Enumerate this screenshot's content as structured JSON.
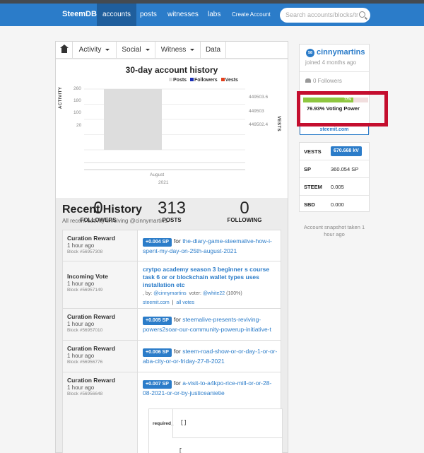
{
  "nav": {
    "brand": "SteemDB",
    "links": [
      "accounts",
      "posts",
      "witnesses",
      "labs",
      "Create Account"
    ],
    "search_placeholder": "Search accounts/blocks/tr"
  },
  "tabs": [
    "Activity",
    "Social",
    "Witness",
    "Data"
  ],
  "chart": {
    "title": "30-day account history",
    "legend": [
      {
        "label": "Posts",
        "color": "#dddddd"
      },
      {
        "label": "Followers",
        "color": "#1a2fb5"
      },
      {
        "label": "Vests",
        "color": "#e2401c"
      }
    ],
    "left_axis_label": "ACTIVITY",
    "right_axis_label": "VESTS",
    "left_ticks": [
      "260",
      "180",
      "100",
      "20"
    ],
    "right_ticks": [
      "449503.6",
      "449503",
      "449502.4"
    ],
    "x_month": "August",
    "x_year": "2021"
  },
  "chart_data": {
    "type": "bar",
    "title": "30-day account history",
    "categories": [
      "August 2021"
    ],
    "series": [
      {
        "name": "Posts",
        "values": [
          313
        ]
      }
    ],
    "ylabel": "ACTIVITY",
    "y2label": "VESTS",
    "ylim": [
      0,
      280
    ]
  },
  "stats": [
    {
      "value": "0",
      "label": "FOLLOWERS"
    },
    {
      "value": "313",
      "label": "POSTS"
    },
    {
      "value": "0",
      "label": "FOLLOWING"
    }
  ],
  "history": {
    "title": "Recent History",
    "subtitle": "All recent activity involving @cinnymartins.",
    "rows": [
      {
        "type": "Curation Reward",
        "time": "1 hour ago",
        "block": "Block #56957308",
        "badge": "+0.004 SP",
        "text": "for",
        "link": "the-diary-game-steemalive-how-i-spent-my-day-on-25th-august-2021"
      },
      {
        "type": "Incoming Vote",
        "time": "1 hour ago",
        "block": "Block #56957149",
        "vote_title": "crytpo academy season 3 beginner s course task 6 or or blockchain wallet types uses installation etc",
        "by_prefix": ", by: ",
        "author": "@cinnymartins",
        "voter_prefix": "voter: ",
        "voter": "@white22",
        "pct": "(100%)",
        "site": "steemit.com",
        "all_votes": "all votes"
      },
      {
        "type": "Curation Reward",
        "time": "1 hour ago",
        "block": "Block #56957010",
        "badge": "+0.005 SP",
        "text": "for",
        "link": "steemalive-presents-reviving-powers2soar-our-community-powerup-initiative-t"
      },
      {
        "type": "Curation Reward",
        "time": "1 hour ago",
        "block": "Block #56956776",
        "badge": "+0.006 SP",
        "text": "for",
        "link": "steem-road-show-or-or-day-1-or-or-aba-city-or-or-friday-27-8-2021"
      },
      {
        "type": "Curation Reward",
        "time": "1 hour ago",
        "block": "Block #56956648",
        "badge": "+0.007 SP",
        "text": "for",
        "link": "a-visit-to-a4kpo-rice-mill-or-or-28-08-2021-or-or-by-justiceanietie"
      }
    ],
    "sub_key": "required_",
    "sub_value": "[]",
    "sub_value2": "["
  },
  "profile": {
    "avatar": "58",
    "username": "cinnymartins",
    "joined": "joined 4 months ago",
    "followers": "0 Followers",
    "voting_power_value": 76.93,
    "voting_power_badge": "77%",
    "voting_power_text": "76.93% Voting Power",
    "steemit_link": "steemit.com"
  },
  "vests": [
    {
      "key": "VESTS",
      "value": "670.668 kV"
    },
    {
      "key": "SP",
      "value": "360.054 SP"
    },
    {
      "key": "STEEM",
      "value": "0.005"
    },
    {
      "key": "SBD",
      "value": "0.000"
    }
  ],
  "snapshot_note": "Account snapshot taken 1 hour ago",
  "highlight_color": "#c40e2e"
}
